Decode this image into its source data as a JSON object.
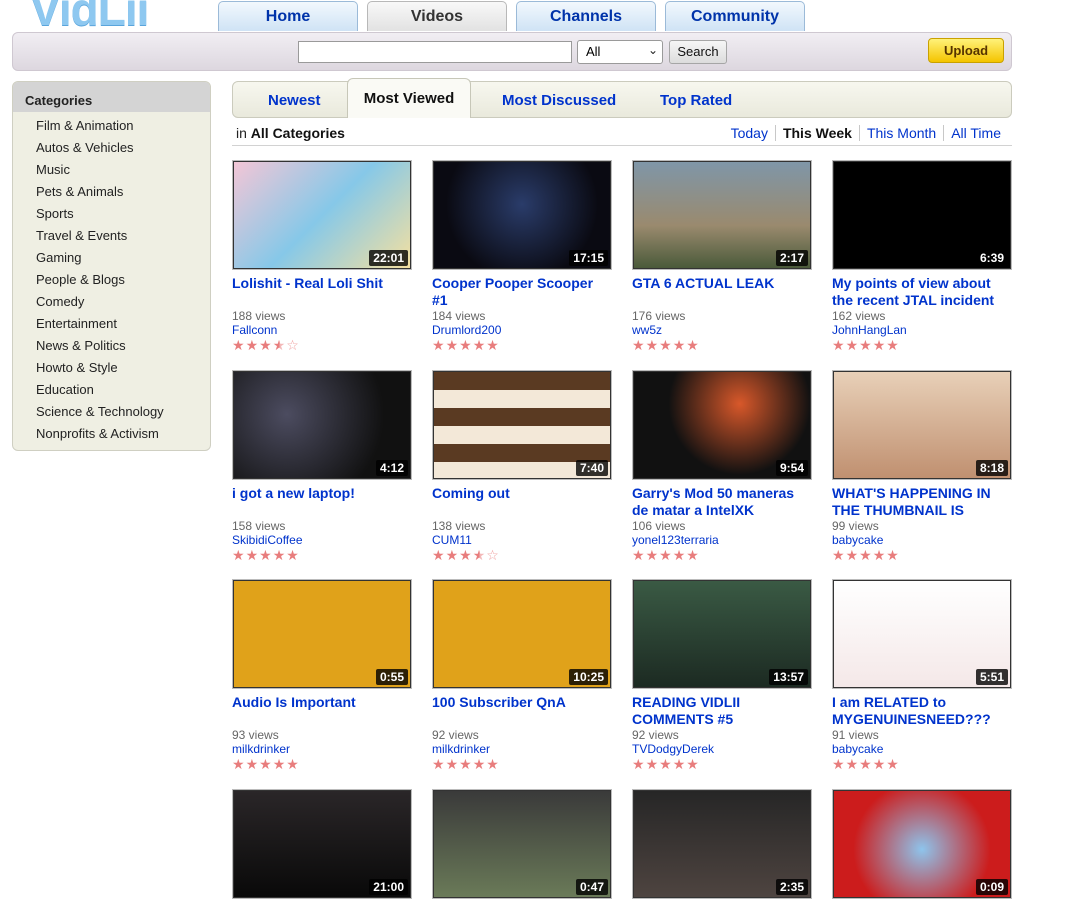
{
  "site": {
    "logo_text": "VidLii"
  },
  "nav": {
    "tabs": [
      {
        "label": "Home"
      },
      {
        "label": "Videos"
      },
      {
        "label": "Channels"
      },
      {
        "label": "Community"
      }
    ],
    "active": "Videos"
  },
  "search": {
    "value": "",
    "scope": "All",
    "button_label": "Search",
    "upload_label": "Upload"
  },
  "sidebar": {
    "title": "Categories",
    "items": [
      "Film & Animation",
      "Autos & Vehicles",
      "Music",
      "Pets & Animals",
      "Sports",
      "Travel & Events",
      "Gaming",
      "People & Blogs",
      "Comedy",
      "Entertainment",
      "News & Politics",
      "Howto & Style",
      "Education",
      "Science & Technology",
      "Nonprofits & Activism"
    ]
  },
  "sort_tabs": [
    "Newest",
    "Most Viewed",
    "Most Discussed",
    "Top Rated"
  ],
  "sort_active": "Most Viewed",
  "filter": {
    "in_label": "in",
    "category": "All Categories",
    "time": [
      "Today",
      "This Week",
      "This Month",
      "All Time"
    ],
    "time_active": "This Week"
  },
  "colors": {
    "link": "#0033cc",
    "star": "#e87d7d",
    "upload": "#f4c400"
  },
  "videos": [
    {
      "title": "Lolishit - Real Loli Shit",
      "views": "188 views",
      "user": "Fallconn",
      "duration": "22:01",
      "rating": 3.5
    },
    {
      "title": "Cooper Pooper Scooper #1",
      "views": "184 views",
      "user": "Drumlord200",
      "duration": "17:15",
      "rating": 5
    },
    {
      "title": "GTA 6 ACTUAL LEAK",
      "views": "176 views",
      "user": "ww5z",
      "duration": "2:17",
      "rating": 5
    },
    {
      "title": "My points of view about the recent JTAL incident",
      "views": "162 views",
      "user": "JohnHangLan",
      "duration": "6:39",
      "rating": 5
    },
    {
      "title": "i got a new laptop!",
      "views": "158 views",
      "user": "SkibidiCoffee",
      "duration": "4:12",
      "rating": 5
    },
    {
      "title": "Coming out",
      "views": "138 views",
      "user": "CUM11",
      "duration": "7:40",
      "rating": 3.5
    },
    {
      "title": "Garry's Mod 50 maneras de matar a IntelXK",
      "views": "106 views",
      "user": "yonel123terraria",
      "duration": "9:54",
      "rating": 5
    },
    {
      "title": "WHAT'S HAPPENING IN THE THUMBNAIL IS",
      "views": "99 views",
      "user": "babycake",
      "duration": "8:18",
      "rating": 5
    },
    {
      "title": "Audio Is Important",
      "views": "93 views",
      "user": "milkdrinker",
      "duration": "0:55",
      "rating": 5
    },
    {
      "title": "100 Subscriber QnA",
      "views": "92 views",
      "user": "milkdrinker",
      "duration": "10:25",
      "rating": 5
    },
    {
      "title": "READING VIDLII COMMENTS #5",
      "views": "92 views",
      "user": "TVDodgyDerek",
      "duration": "13:57",
      "rating": 5
    },
    {
      "title": "I am RELATED to MYGENUINESNEED???",
      "views": "91 views",
      "user": "babycake",
      "duration": "5:51",
      "rating": 5
    },
    {
      "title": "",
      "views": "",
      "user": "",
      "duration": "21:00",
      "rating": 0
    },
    {
      "title": "",
      "views": "",
      "user": "",
      "duration": "0:47",
      "rating": 0
    },
    {
      "title": "",
      "views": "",
      "user": "",
      "duration": "2:35",
      "rating": 0
    },
    {
      "title": "",
      "views": "",
      "user": "",
      "duration": "0:09",
      "rating": 0
    }
  ]
}
